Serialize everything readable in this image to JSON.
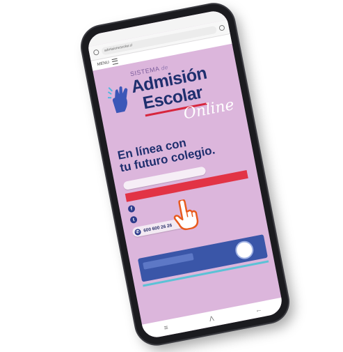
{
  "browser": {
    "url": "admisionescolar.cl"
  },
  "menu": {
    "label": "MENU"
  },
  "hero": {
    "sistema": "SISTEMA",
    "de": "de",
    "admision": "Admisión",
    "escolar": "Escolar",
    "online": "Online",
    "tagline_line1": "En línea con",
    "tagline_line2": "tu futuro colegio."
  },
  "contact": {
    "phone": "600 600 26 26"
  },
  "colors": {
    "brand_navy": "#1f2f6e",
    "accent_red": "#e23345",
    "screen_bg": "#dcb6dc",
    "banner_blue": "#3a56a8"
  },
  "icons": {
    "facebook": "facebook-icon",
    "twitter": "twitter-icon",
    "phone": "phone-icon",
    "pointer": "pointer-hand-icon"
  }
}
